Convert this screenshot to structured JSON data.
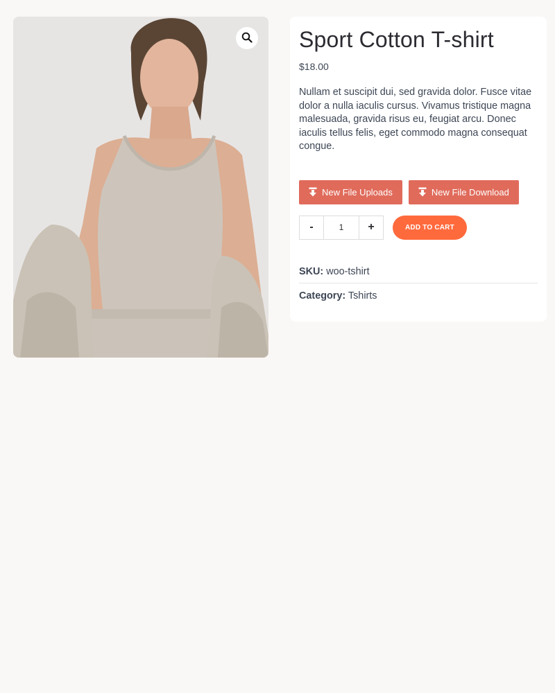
{
  "product": {
    "title": "Sport Cotton T-shirt",
    "price": "$18.00",
    "description": "Nullam et suscipit dui, sed gravida dolor. Fusce vitae dolor a nulla iaculis cursus. Vivamus tristique magna malesuada, gravida risus eu, feugiat arcu. Donec iaculis tellus felis, eget commodo magna consequat congue.",
    "image": {
      "zoom_icon": "magnifier-icon"
    }
  },
  "file_buttons": [
    {
      "label": "New File Uploads",
      "icon": "download-icon"
    },
    {
      "label": "New File Download",
      "icon": "download-icon"
    }
  ],
  "cart": {
    "minus_label": "-",
    "plus_label": "+",
    "quantity": "1",
    "add_label": "ADD TO CART"
  },
  "meta": {
    "sku_label": "SKU:",
    "sku_value": "woo-tshirt",
    "category_label": "Category:",
    "category_value": "Tshirts"
  },
  "colors": {
    "page_bg": "#faf8f6",
    "file_button": "#e06b5b",
    "add_to_cart": "#ff6a3d",
    "text": "#3d4655"
  }
}
